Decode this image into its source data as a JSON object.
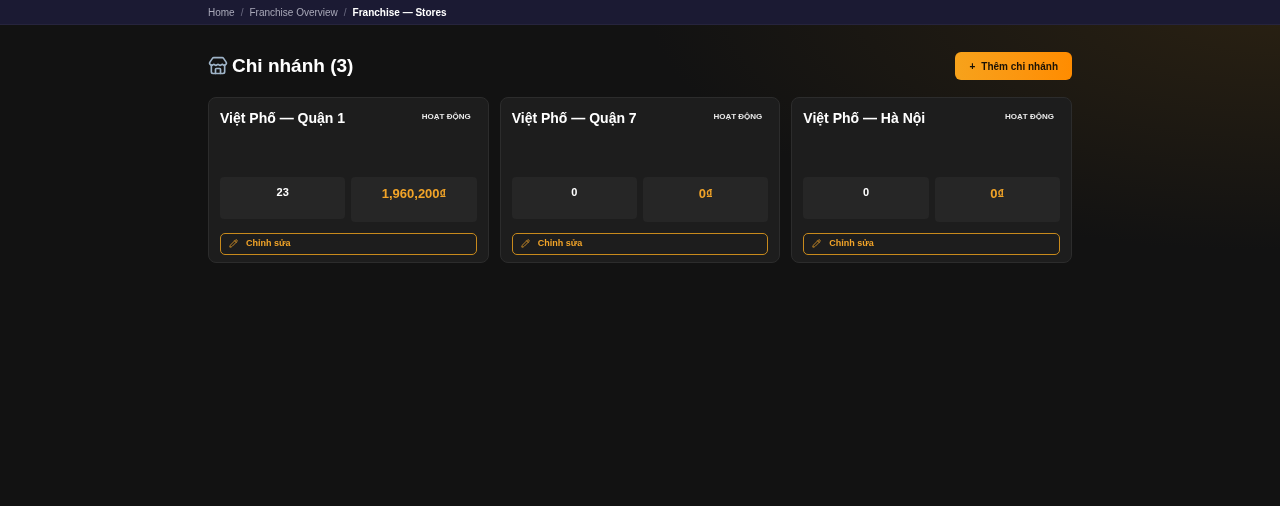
{
  "breadcrumb_separator": "/",
  "breadcrumb": [
    {
      "label": "Home",
      "current": false
    },
    {
      "label": "Franchise Overview",
      "current": false
    },
    {
      "label": "Franchise — Stores",
      "current": true
    }
  ],
  "title": "Chi nhánh (3)",
  "add_button": {
    "icon": "+",
    "label": "Thêm chi nhánh"
  },
  "stores": [
    {
      "name": "Việt Phố — Quận 1",
      "status": "HOẠT ĐỘNG",
      "count": "23",
      "revenue": "1,960,200₫",
      "edit": "Chỉnh sửa"
    },
    {
      "name": "Việt Phố — Quận 7",
      "status": "HOẠT ĐỘNG",
      "count": "0",
      "revenue": "0₫",
      "edit": "Chỉnh sửa"
    },
    {
      "name": "Việt Phố — Hà Nội",
      "status": "HOẠT ĐỘNG",
      "count": "0",
      "revenue": "0₫",
      "edit": "Chỉnh sửa"
    }
  ]
}
